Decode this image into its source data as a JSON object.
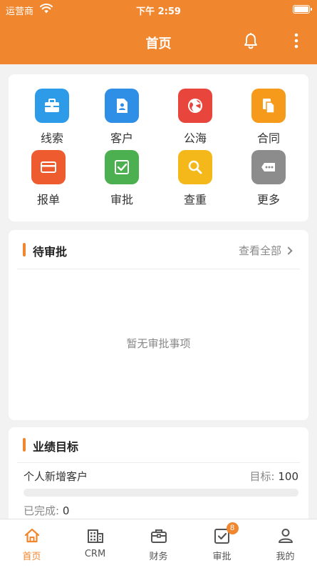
{
  "status_bar": {
    "carrier": "运营商",
    "time": "下午 2:59"
  },
  "nav": {
    "title": "首页",
    "bell_icon": "bell-icon",
    "more_icon": "more-vertical-icon"
  },
  "grid": [
    {
      "label": "线索",
      "icon": "briefcase-icon",
      "color": "#2e9be8"
    },
    {
      "label": "客户",
      "icon": "contact-card-icon",
      "color": "#2f8ee6"
    },
    {
      "label": "公海",
      "icon": "globe-icon",
      "color": "#e8453c"
    },
    {
      "label": "合同",
      "icon": "documents-icon",
      "color": "#f59a1b"
    },
    {
      "label": "报单",
      "icon": "card-icon",
      "color": "#ee5b2e"
    },
    {
      "label": "审批",
      "icon": "check-square-icon",
      "color": "#4caf50"
    },
    {
      "label": "查重",
      "icon": "search-icon",
      "color": "#f5b81a"
    },
    {
      "label": "更多",
      "icon": "more-horizontal-icon",
      "color": "#8c8c8c"
    }
  ],
  "pending": {
    "title": "待审批",
    "view_all": "查看全部",
    "empty": "暂无审批事项"
  },
  "target": {
    "title": "业绩目标",
    "item_label": "个人新增客户",
    "goal_label": "目标:",
    "goal_value": "100",
    "done_label": "已完成:",
    "done_value": "0",
    "progress": 0
  },
  "tabbar": {
    "items": [
      {
        "label": "首页",
        "icon": "home-icon",
        "active": true
      },
      {
        "label": "CRM",
        "icon": "building-icon"
      },
      {
        "label": "财务",
        "icon": "wallet-icon"
      },
      {
        "label": "审批",
        "icon": "approval-icon",
        "badge": "8"
      },
      {
        "label": "我的",
        "icon": "user-icon"
      }
    ]
  },
  "colors": {
    "accent": "#f0872f"
  }
}
